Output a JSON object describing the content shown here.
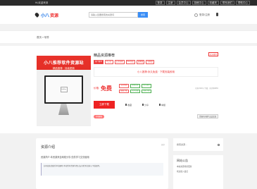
{
  "topbar": {
    "greeting": "Hi,欢迎来到",
    "links": [
      "登录",
      "注册",
      "会员中心",
      "投稿中心",
      "收藏夹",
      "联系我们",
      "帮助中心"
    ]
  },
  "header": {
    "logo_text": "小八",
    "logo_brand": "资源",
    "search_placeholder": "请输入您要搜索的关键词",
    "search_button": "搜索",
    "user_label": "登录/注册"
  },
  "breadcrumb": "首页 > 软件",
  "product": {
    "cover_title": "小八推荐软件资源站",
    "cover_subtitle": "精品推荐 · 持续更新",
    "screen_label": "SoftBox",
    "title": "精品资源推荐",
    "badge": "官方推荐",
    "tags": [
      "热门推荐",
      "已认证",
      "安全无毒",
      "Win系统",
      "破解版",
      "绿色版"
    ],
    "notice": "小八推荐:永久免费 · 下载安装即用",
    "price_label": "价格:",
    "price_value": "免费",
    "features": [
      "会员免费",
      "原创资源",
      "永久更新",
      "极速下载",
      "官方正版",
      "无限下载"
    ],
    "side_hint": "已有1520人下载 · 好评率98%",
    "buy_button": "立即下载",
    "actions": [
      "收藏",
      "分享",
      "举报"
    ],
    "pill": "QQ客服",
    "report": "资源有问题?点此反馈"
  },
  "lower": {
    "card_title": "资源介绍",
    "card_more": "更多",
    "card_line": "资源简介:本资源来自网络分享,仅供学习交流使用",
    "card_quote": "如有侵权请联系本站删除,本站所有资源均经过安全检测,请放心下载使用。",
    "aside_search": "搜索资源...",
    "aside_notice_title": "网站公告",
    "aside_notice_lines": [
      "本站资源持续更新",
      "欢迎加入会员"
    ]
  },
  "colors": {
    "accent": "#e33333",
    "button_blue": "#3a8ef6",
    "topbar": "#2b2b2b"
  }
}
